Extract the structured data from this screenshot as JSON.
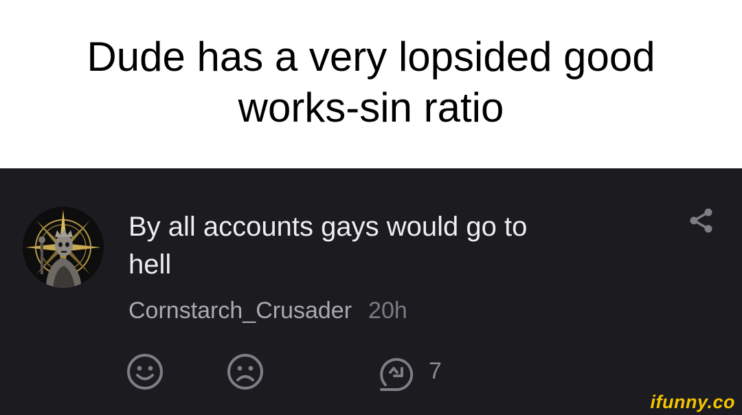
{
  "caption": {
    "line1": "Dude has a very lopsided good",
    "line2": "works-sin ratio"
  },
  "comment": {
    "text_line1": "By all accounts gays would go to",
    "text_line2": "hell",
    "username": "Cornstarch_Crusader",
    "timestamp": "20h",
    "reply_count": "7"
  },
  "icons": {
    "share": "share-icon",
    "like": "smile-icon",
    "dislike": "frown-icon",
    "reply": "reply-icon",
    "avatar": "compass-knight-avatar"
  },
  "watermark": "ifunny.co",
  "colors": {
    "panel_background": "#1b1b20",
    "brand_yellow": "#f5c400",
    "icon_gray": "#7e7e85"
  }
}
